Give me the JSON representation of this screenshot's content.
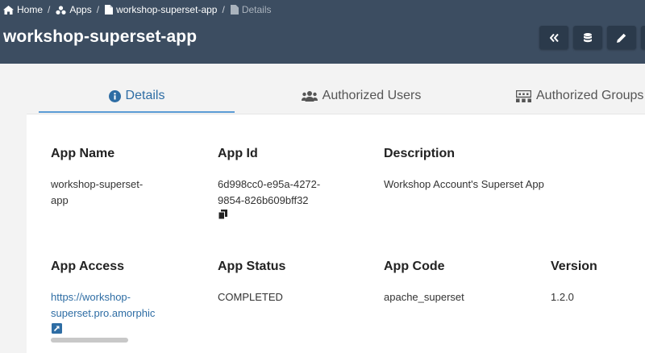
{
  "breadcrumb": {
    "home": "Home",
    "apps": "Apps",
    "app": "workshop-superset-app",
    "current": "Details",
    "separator": "/"
  },
  "header": {
    "title": "workshop-superset-app",
    "buttons": [
      "back-icon",
      "database-icon",
      "edit-icon"
    ]
  },
  "tabs": {
    "details": "Details",
    "authorized_users": "Authorized Users",
    "authorized_groups": "Authorized Groups"
  },
  "details": {
    "app_name_label": "App Name",
    "app_name_line1": "workshop-superset-",
    "app_name_line2": "app",
    "app_id_label": "App Id",
    "app_id_line1": "6d998cc0-e95a-4272-",
    "app_id_line2": "9854-826b609bff32",
    "description_label": "Description",
    "description": "Workshop Account's Superset App",
    "app_access_label": "App Access",
    "app_access_line1": "https://workshop-",
    "app_access_line2": "superset.pro.amorphic",
    "app_status_label": "App Status",
    "app_status": "COMPLETED",
    "app_code_label": "App Code",
    "app_code": "apache_superset",
    "version_label": "Version",
    "version": "1.2.0"
  },
  "colors": {
    "header_bg": "#3c4d61",
    "button_bg": "#2b3a4b",
    "active_tab": "#2e6da4",
    "link": "#2e6da4"
  }
}
